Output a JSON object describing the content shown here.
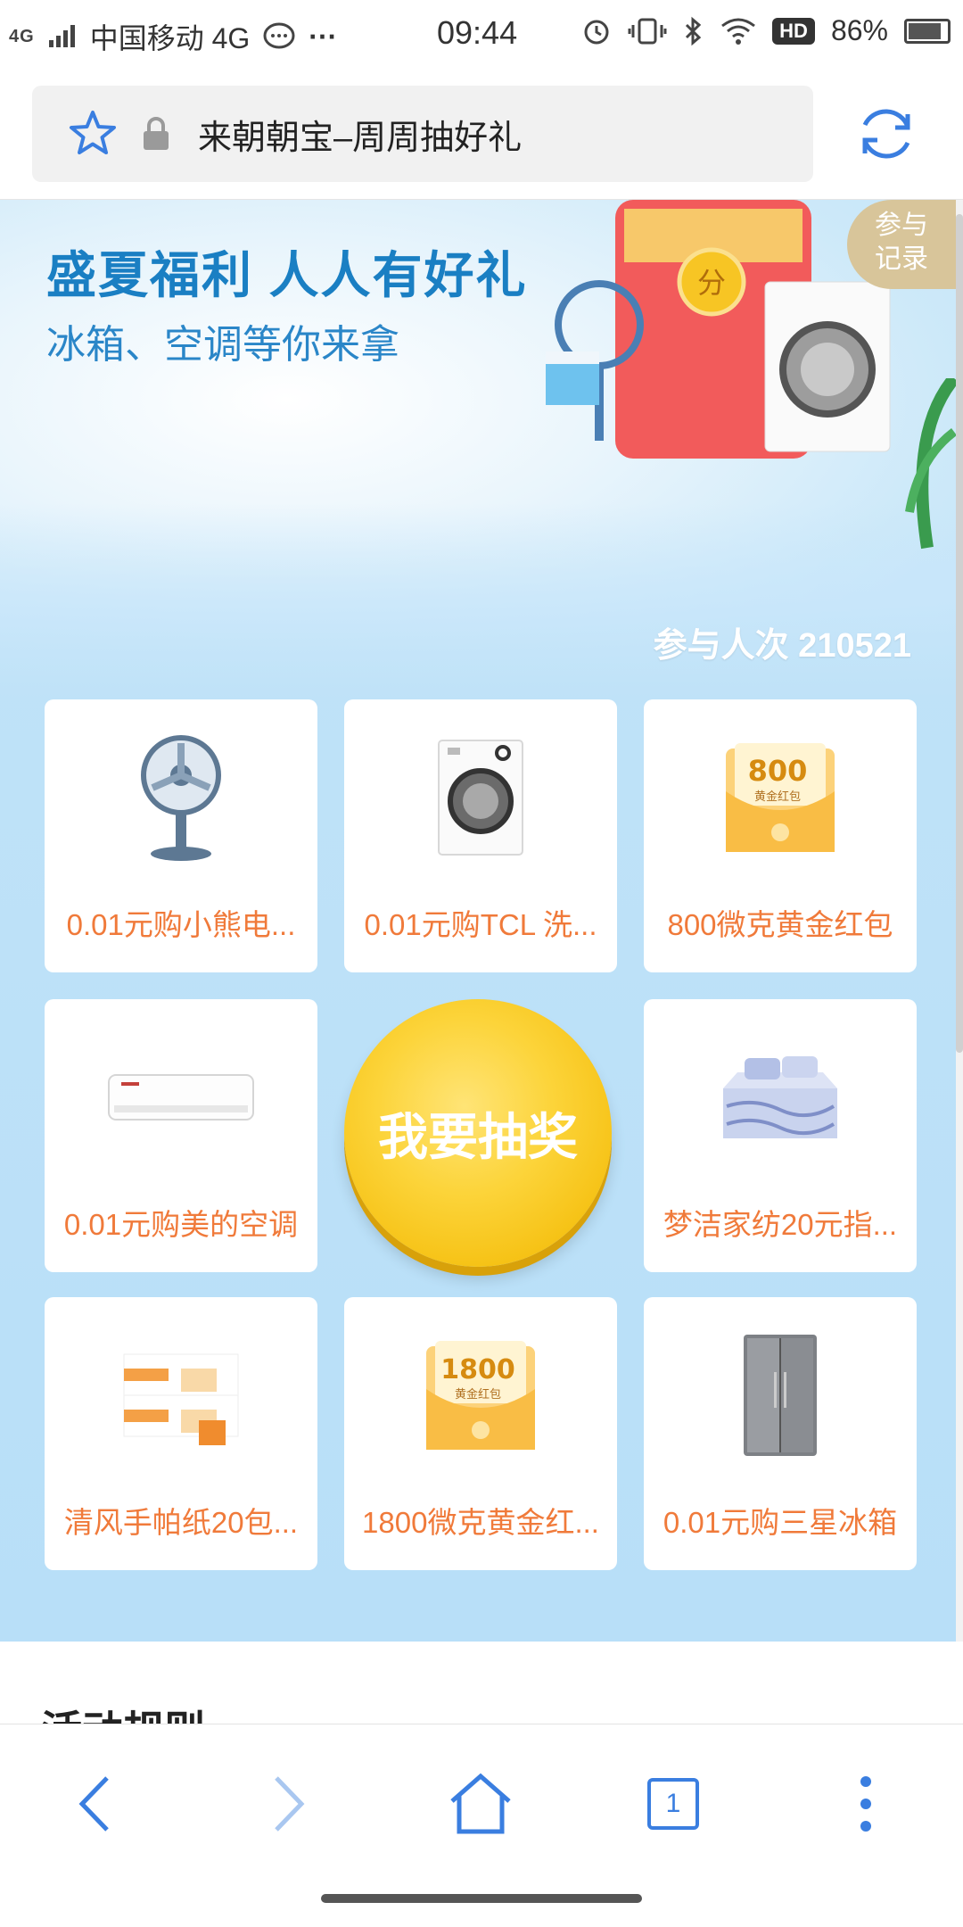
{
  "status_bar": {
    "signal": "4G",
    "carrier": "中国移动 4G",
    "time": "09:44",
    "hd": "HD",
    "battery": "86%"
  },
  "address_bar": {
    "title": "来朝朝宝–周周抽好礼"
  },
  "hero": {
    "headline": "盛夏福利 人人有好礼",
    "subheadline": "冰箱、空调等你来拿",
    "record_button": [
      "参与",
      "记录"
    ],
    "participants": "参与人次 210521",
    "coin_char": "分"
  },
  "prizes": [
    {
      "label": "0.01元购小熊电...",
      "icon": "fan"
    },
    {
      "label": "0.01元购TCL 洗...",
      "icon": "washing-machine"
    },
    {
      "label": "800微克黄金红包",
      "icon": "gold-envelope",
      "amount": "800"
    },
    {
      "label": "0.01元购美的空调",
      "icon": "air-conditioner"
    },
    {
      "label": "梦洁家纺20元指...",
      "icon": "bedding"
    },
    {
      "label": "清风手帕纸20包...",
      "icon": "tissues"
    },
    {
      "label": "1800微克黄金红...",
      "icon": "gold-envelope",
      "amount": "1800"
    },
    {
      "label": "0.01元购三星冰箱",
      "icon": "refrigerator"
    }
  ],
  "envelope_caption": "黄金红包",
  "draw_button": "我要抽奖",
  "rules_title": "活动规则",
  "tab_count": "1",
  "colors": {
    "accent_blue": "#3a7ee0",
    "prize_text": "#f07a3a",
    "gold": "#f6c215"
  }
}
